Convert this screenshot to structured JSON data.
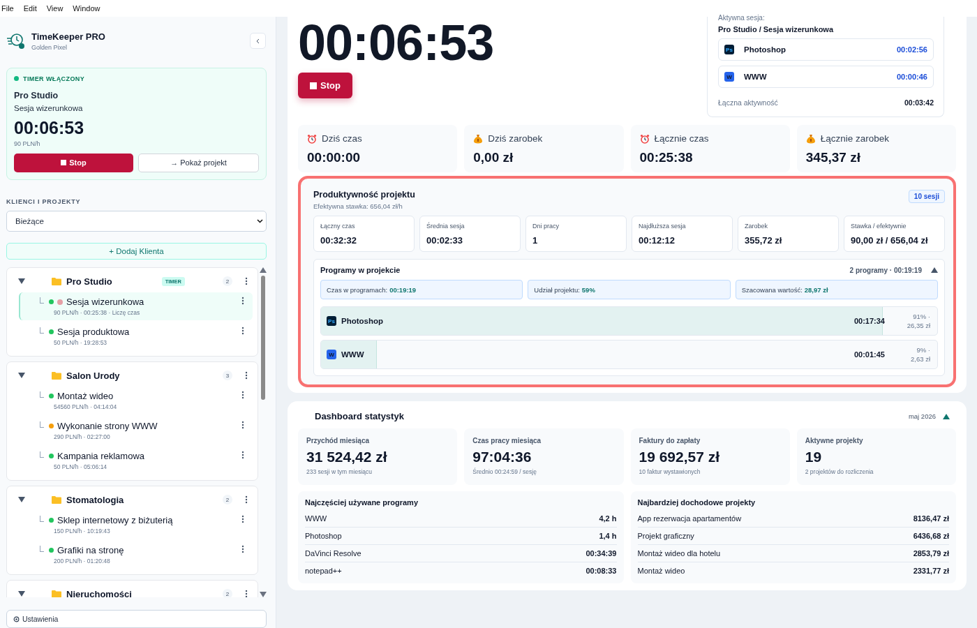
{
  "menu": [
    "File",
    "Edit",
    "View",
    "Window"
  ],
  "sidebar": {
    "app_name": "TimeKeeper PRO",
    "company": "Golden Pixel",
    "timer_card": {
      "status": "TIMER WŁĄCZONY",
      "on": true,
      "client": "Pro Studio",
      "project": "Sesja wizerunkowa",
      "time": "00:06:53",
      "rate": "90 PLN/h",
      "stop": "Stop",
      "show": "→ Pokaż projekt"
    },
    "section_label": "KLIENCI I PROJEKTY",
    "filter": "Bieżące",
    "add_client": "+ Dodaj Klienta",
    "clients": [
      {
        "name": "Pro Studio",
        "badge": "TIMER",
        "count": "2",
        "expanded": true,
        "children": [
          {
            "name": "Sesja wizerunkowa",
            "meta": "90 PLN/h · 00:25:38 · Liczę czas",
            "color": "#22c55e",
            "recording": true,
            "selected": true
          },
          {
            "name": "Sesja produktowa",
            "meta": "50 PLN/h · 19:28:53",
            "color": "#22c55e",
            "recording": false,
            "selected": false
          }
        ]
      },
      {
        "name": "Salon Urody",
        "count": "3",
        "expanded": true,
        "children": [
          {
            "name": "Montaż wideo",
            "meta": "54560 PLN/h · 04:14:04",
            "color": "#22c55e",
            "recording": false,
            "selected": false
          },
          {
            "name": "Wykonanie strony WWW",
            "meta": "290 PLN/h · 02:27:00",
            "color": "#f59e0b",
            "recording": false,
            "selected": false
          },
          {
            "name": "Kampania reklamowa",
            "meta": "50 PLN/h · 05:06:14",
            "color": "#22c55e",
            "recording": false,
            "selected": false
          }
        ]
      },
      {
        "name": "Stomatologia",
        "count": "2",
        "expanded": true,
        "children": [
          {
            "name": "Sklep internetowy z biżuterią",
            "meta": "150 PLN/h · 10:19:43",
            "color": "#22c55e",
            "recording": false,
            "selected": false
          },
          {
            "name": "Grafiki na stronę",
            "meta": "200 PLN/h · 01:20:48",
            "color": "#22c55e",
            "recording": false,
            "selected": false
          }
        ]
      },
      {
        "name": "Nieruchomości",
        "count": "2",
        "expanded": true
      }
    ],
    "settings": "Ustawienia"
  },
  "timer": {
    "time": "00:06:53",
    "stop": "Stop"
  },
  "active_session": {
    "label": "Aktywna sesja:",
    "session": "Pro Studio / Sesja wizerunkowa",
    "programs": [
      {
        "icon_label": "Ps",
        "kind": "ps",
        "name": "Photoshop",
        "time": "00:02:56"
      },
      {
        "icon_label": "W",
        "kind": "web",
        "name": "WWW",
        "time": "00:00:46"
      }
    ],
    "total_label": "Łączna aktywność",
    "total": "00:03:42"
  },
  "stats": [
    {
      "kind": "time",
      "label": "Dziś czas",
      "value": "00:00:00"
    },
    {
      "kind": "money",
      "label": "Dziś zarobek",
      "value": "0,00 zł"
    },
    {
      "kind": "time",
      "label": "Łącznie czas",
      "value": "00:25:38"
    },
    {
      "kind": "money",
      "label": "Łącznie zarobek",
      "value": "345,37 zł"
    }
  ],
  "productivity": {
    "title": "Produktywność projektu",
    "subtitle": "Efektywna stawka: 656,04 zł/h",
    "badge": "10 sesji",
    "metrics": [
      {
        "label": "Łączny czas",
        "value": "00:32:32"
      },
      {
        "label": "Średnia sesja",
        "value": "00:02:33"
      },
      {
        "label": "Dni pracy",
        "value": "1"
      },
      {
        "label": "Najdłuższa sesja",
        "value": "00:12:12"
      },
      {
        "label": "Zarobek",
        "value": "355,72 zł"
      },
      {
        "label": "Stawka / efektywnie",
        "value": "90,00 zł / 656,04 zł"
      }
    ],
    "programs_panel": {
      "title": "Programy w projekcie",
      "summary": "2 programy · 00:19:19",
      "expanded": true,
      "chips": [
        {
          "label": "Czas w programach:",
          "value": "00:19:19"
        },
        {
          "label": "Udział projektu:",
          "value": "59%"
        },
        {
          "label": "Szacowana wartość:",
          "value": "28,97 zł"
        }
      ],
      "rows": [
        {
          "icon_label": "Ps",
          "kind": "ps",
          "name": "Photoshop",
          "time": "00:17:34",
          "share": "91% ·",
          "value": "26,35 zł",
          "level": 0.91
        },
        {
          "icon_label": "W",
          "kind": "web",
          "name": "WWW",
          "time": "00:01:45",
          "share": "9% ·",
          "value": "2,63 zł",
          "level": 0.09
        }
      ]
    }
  },
  "dashboard": {
    "title": "Dashboard statystyk",
    "month": "maj 2026",
    "expanded": true,
    "cards": [
      {
        "label": "Przychód miesiąca",
        "value": "31 524,42 zł",
        "note": "233 sesji w tym miesiącu"
      },
      {
        "label": "Czas pracy miesiąca",
        "value": "97:04:36",
        "note": "Średnio 00:24:59 / sesję"
      },
      {
        "label": "Faktury do zapłaty",
        "value": "19 692,57 zł",
        "note": "10 faktur wystawionych"
      },
      {
        "label": "Aktywne projekty",
        "value": "19",
        "note": "2 projektów do rozliczenia"
      }
    ],
    "lists": [
      {
        "title": "Najczęściej używane programy",
        "rows": [
          {
            "name": "WWW",
            "value": "4,2 h"
          },
          {
            "name": "Photoshop",
            "value": "1,4 h"
          },
          {
            "name": "DaVinci Resolve",
            "value": "00:34:39"
          },
          {
            "name": "notepad++",
            "value": "00:08:33"
          }
        ]
      },
      {
        "title": "Najbardziej dochodowe projekty",
        "rows": [
          {
            "name": "App rezerwacja apartamentów",
            "value": "8136,47 zł"
          },
          {
            "name": "Projekt graficzny",
            "value": "6436,68 zł"
          },
          {
            "name": "Montaż wideo dla hotelu",
            "value": "2853,79 zł"
          },
          {
            "name": "Montaż wideo",
            "value": "2331,77 zł"
          }
        ]
      }
    ]
  }
}
